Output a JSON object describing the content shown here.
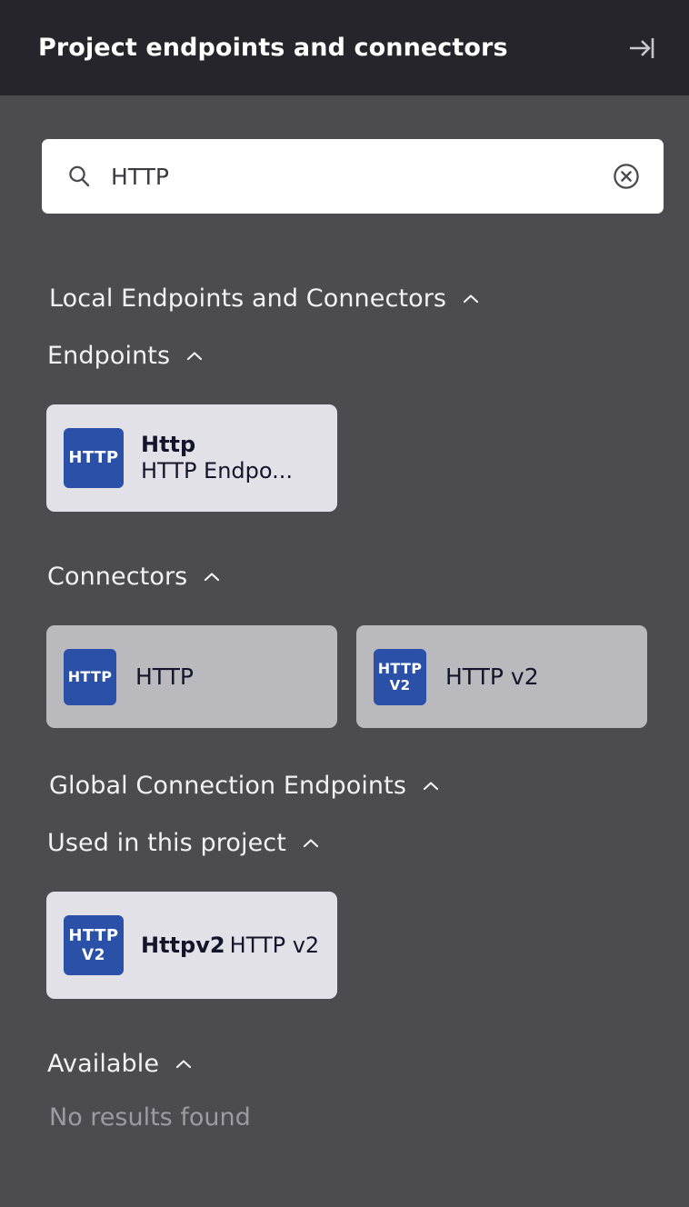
{
  "header": {
    "title": "Project endpoints and connectors",
    "collapse_icon": "collapse-right-icon"
  },
  "search": {
    "value": "HTTP",
    "placeholder": "Search",
    "search_icon": "search-icon",
    "clear_icon": "clear-circle-x-icon"
  },
  "colors": {
    "header_bg": "#26252b",
    "panel_bg": "#4b4b50",
    "card_light": "#e2e1e7",
    "card_gray": "#b9b9be",
    "brand_blue": "#2a50a8",
    "card_text": "#14142b",
    "muted_text": "#9b9ba1"
  },
  "sections": {
    "local": {
      "label": "Local Endpoints and Connectors",
      "chevron": "chevron-up-icon",
      "endpoints": {
        "label": "Endpoints",
        "chevron": "chevron-up-icon",
        "items": [
          {
            "glyph_line1": "HTTP",
            "glyph_line2": "",
            "title": "Http",
            "subtitle": "HTTP Endpo..."
          }
        ]
      },
      "connectors": {
        "label": "Connectors",
        "chevron": "chevron-up-icon",
        "items": [
          {
            "glyph_line1": "HTTP",
            "glyph_line2": "",
            "label": "HTTP"
          },
          {
            "glyph_line1": "HTTP",
            "glyph_line2": "V2",
            "label": "HTTP v2"
          }
        ]
      }
    },
    "global": {
      "label": "Global Connection Endpoints",
      "chevron": "chevron-up-icon",
      "used": {
        "label": "Used in this project",
        "chevron": "chevron-up-icon",
        "items": [
          {
            "glyph_line1": "HTTP",
            "glyph_line2": "V2",
            "title": "Httpv2",
            "subtitle": "HTTP v2"
          }
        ]
      },
      "available": {
        "label": "Available",
        "chevron": "chevron-up-icon",
        "empty_text": "No results found"
      }
    }
  }
}
